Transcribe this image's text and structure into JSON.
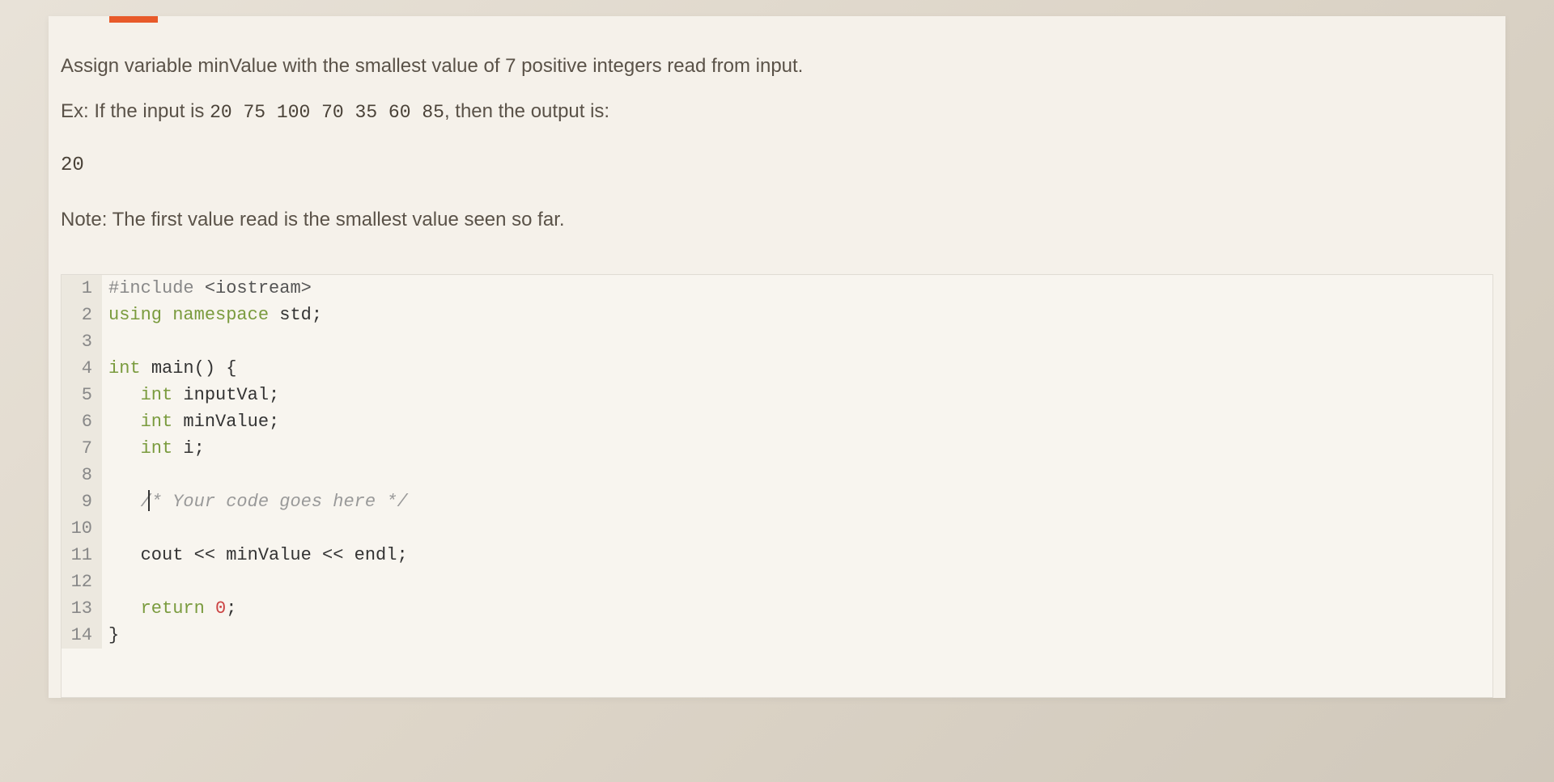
{
  "problem": {
    "description_pre": "Assign variable minValue with the smallest value of 7 positive integers read from input.",
    "example_prefix": "Ex: If the input is ",
    "example_input": "20 75 100 70 35 60 85",
    "example_suffix": ", then the output is:",
    "example_output": "20",
    "note": "Note: The first value read is the smallest value seen so far."
  },
  "code": {
    "lines": [
      {
        "n": "1",
        "segments": [
          {
            "t": "#include ",
            "c": "preprocessor"
          },
          {
            "t": "<iostream>",
            "c": "string-inc"
          }
        ]
      },
      {
        "n": "2",
        "segments": [
          {
            "t": "using ",
            "c": "keyword"
          },
          {
            "t": "namespace ",
            "c": "keyword"
          },
          {
            "t": "std",
            "c": ""
          },
          {
            "t": ";",
            "c": ""
          }
        ]
      },
      {
        "n": "3",
        "segments": []
      },
      {
        "n": "4",
        "segments": [
          {
            "t": "int ",
            "c": "type"
          },
          {
            "t": "main",
            "c": ""
          },
          {
            "t": "() {",
            "c": ""
          }
        ]
      },
      {
        "n": "5",
        "segments": [
          {
            "t": "   ",
            "c": ""
          },
          {
            "t": "int ",
            "c": "type"
          },
          {
            "t": "inputVal;",
            "c": ""
          }
        ]
      },
      {
        "n": "6",
        "segments": [
          {
            "t": "   ",
            "c": ""
          },
          {
            "t": "int ",
            "c": "type"
          },
          {
            "t": "minValue;",
            "c": ""
          }
        ]
      },
      {
        "n": "7",
        "segments": [
          {
            "t": "   ",
            "c": ""
          },
          {
            "t": "int ",
            "c": "type"
          },
          {
            "t": "i;",
            "c": ""
          }
        ]
      },
      {
        "n": "8",
        "segments": []
      },
      {
        "n": "9",
        "segments": [
          {
            "t": "   ",
            "c": ""
          },
          {
            "t": "/* Your code goes here */",
            "c": "comment"
          }
        ],
        "cursor": true
      },
      {
        "n": "10",
        "segments": []
      },
      {
        "n": "11",
        "segments": [
          {
            "t": "   cout << minValue << endl;",
            "c": ""
          }
        ]
      },
      {
        "n": "12",
        "segments": []
      },
      {
        "n": "13",
        "segments": [
          {
            "t": "   ",
            "c": ""
          },
          {
            "t": "return ",
            "c": "keyword"
          },
          {
            "t": "0",
            "c": "number"
          },
          {
            "t": ";",
            "c": ""
          }
        ]
      },
      {
        "n": "14",
        "segments": [
          {
            "t": "}",
            "c": ""
          }
        ]
      }
    ]
  }
}
